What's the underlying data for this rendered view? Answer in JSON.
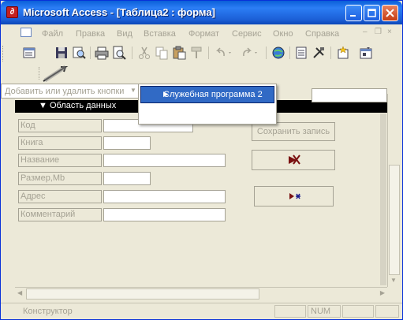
{
  "window": {
    "title": "Microsoft Access - [Таблица2 : форма]",
    "app_icon": "access-key-icon",
    "controls": {
      "minimize": "minimize-icon",
      "maximize": "maximize-icon",
      "close": "close-icon"
    }
  },
  "menubar": {
    "items": [
      "Файл",
      "Правка",
      "Вид",
      "Вставка",
      "Формат",
      "Сервис",
      "Окно",
      "Справка"
    ],
    "doc_controls": {
      "minimize": "–",
      "restore": "❐",
      "close": "×"
    }
  },
  "toolbar": {
    "icons": [
      "form-view-icon",
      "save-icon",
      "search-icon",
      "print-icon",
      "print-preview-icon",
      "cut-icon",
      "copy-icon",
      "paste-icon",
      "format-painter-icon",
      "undo-icon",
      "redo-icon",
      "hyperlink-icon",
      "field-list-icon",
      "toolbox-icon",
      "autoformat-icon",
      "properties-icon"
    ]
  },
  "customize_menu": {
    "label": "Добавить или удалить кнопки",
    "submenu_item": "Служебная программа 2"
  },
  "form": {
    "section_label": "Область данных",
    "fields": [
      {
        "label": "Код"
      },
      {
        "label": "Книга"
      },
      {
        "label": "Название"
      },
      {
        "label": "Размер,Mb"
      },
      {
        "label": "Адрес"
      },
      {
        "label": "Комментарий"
      }
    ],
    "buttons": {
      "save_record": "Сохранить запись",
      "delete_record_icon": "delete-record-icon",
      "new_record_icon": "new-record-icon"
    }
  },
  "statusbar": {
    "mode": "Конструктор",
    "num": "NUM"
  },
  "colors": {
    "title_blue": "#0a5fd8",
    "selection_blue": "#316ac5",
    "disabled_text": "#a5a294",
    "chrome": "#ece9d8"
  }
}
